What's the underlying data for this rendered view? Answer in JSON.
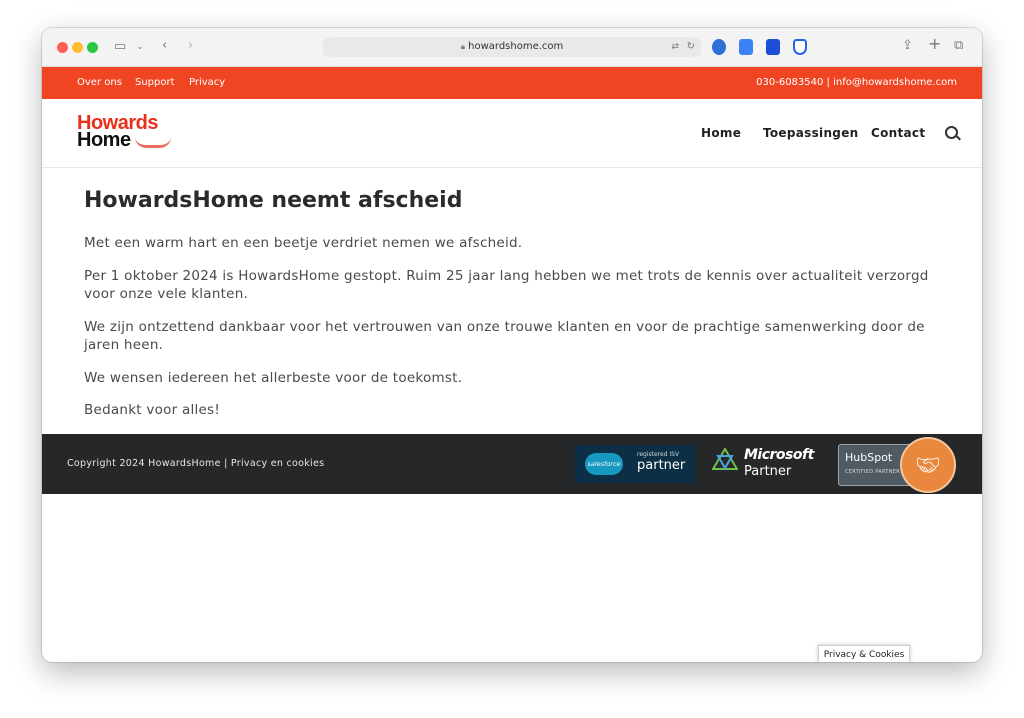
{
  "browser": {
    "url": "howardshome.com"
  },
  "topbar": {
    "links": [
      "Over ons",
      "Support",
      "Privacy"
    ],
    "contact": "030-6083540 | info@howardshome.com"
  },
  "logo": {
    "line1": "Howards",
    "line2": "Home"
  },
  "nav": {
    "items": [
      "Home",
      "Toepassingen",
      "Contact"
    ]
  },
  "main": {
    "title": "HowardsHome neemt afscheid",
    "paragraphs": [
      "Met een warm hart en een beetje verdriet nemen we afscheid.",
      "Per 1 oktober 2024 is HowardsHome gestopt. Ruim 25 jaar lang hebben we met trots de kennis over actualiteit verzorgd voor onze vele klanten.",
      "We zijn ontzettend dankbaar voor het vertrouwen van onze trouwe klanten en voor de prachtige samenwerking door de jaren heen.",
      "We wensen iedereen het allerbeste voor de toekomst.",
      "Bedankt voor alles!"
    ]
  },
  "footer": {
    "copyright": "Copyright 2024 HowardsHome | Privacy en cookies",
    "salesforce": {
      "logo": "salesforce",
      "small": "registered ISV",
      "big": "partner"
    },
    "microsoft": {
      "name": "Microsoft",
      "sub": "Partner"
    },
    "hubspot": {
      "name": "HubSpot",
      "sub": "CERTIFIED PARTNER"
    }
  },
  "cookie_button": "Privacy & Cookies",
  "colors": {
    "accent": "#f04523",
    "footer": "#262729"
  }
}
